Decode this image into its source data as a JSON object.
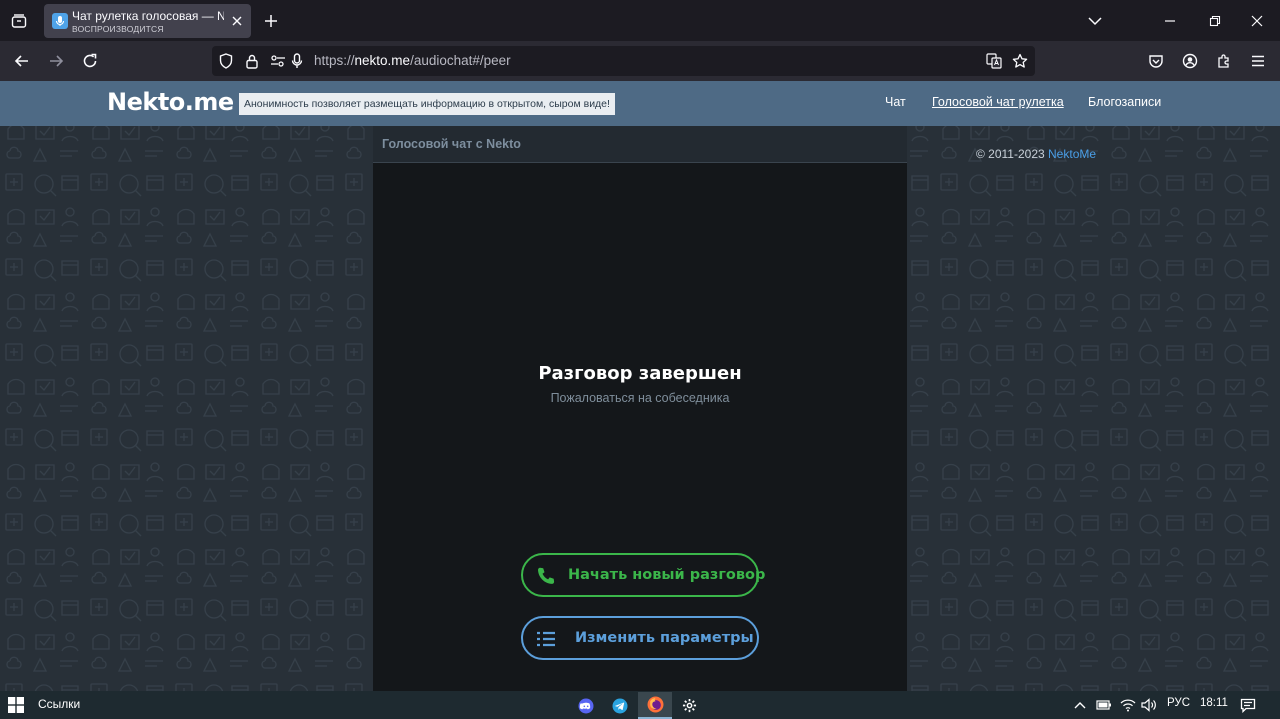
{
  "browser": {
    "tab": {
      "title": "Чат рулетка голосовая — Nekto",
      "status": "ВОСПРОИЗВОДИТСЯ"
    },
    "address_bar": {
      "url_prefix": "https://",
      "url_host": "nekto.me",
      "url_path": "/audiochat#/peer"
    },
    "icons": [
      "list-all-tabs-icon",
      "close-icon",
      "plus-icon",
      "chevron-down-icon",
      "minimize-icon",
      "restore-icon",
      "close-window-icon",
      "back-icon",
      "forward-icon",
      "reload-icon",
      "shield-icon",
      "lock-icon",
      "permissions-icon",
      "microphone-icon",
      "translate-icon",
      "star-icon",
      "pocket-icon",
      "account-icon",
      "extensions-icon",
      "menu-icon"
    ]
  },
  "site": {
    "logo": "Nekto.me",
    "slogan": "Анонимность позволяет размещать информацию в открытом, сыром виде!",
    "nav": [
      {
        "label": "Чат",
        "active": false
      },
      {
        "label": "Голосовой чат рулетка",
        "active": true
      },
      {
        "label": "Блогозаписи",
        "active": false
      }
    ],
    "copyright_prefix": "© 2011-2023",
    "copyright_link": "NektoMe"
  },
  "chat": {
    "panel_title": "Голосовой чат с Nekto",
    "status_title": "Разговор завершен",
    "report_link": "Пожаловаться на собеседника",
    "new_chat_button": "Начать новый разговор",
    "params_button": "Изменить параметры",
    "colors": {
      "new_chat": "#3bb64a",
      "params": "#5c9fdb"
    }
  },
  "taskbar": {
    "links_label": "Ссылки",
    "language": "РУС",
    "time": "18:11",
    "apps": [
      "discord-icon",
      "telegram-icon",
      "firefox-icon",
      "settings-icon"
    ]
  }
}
